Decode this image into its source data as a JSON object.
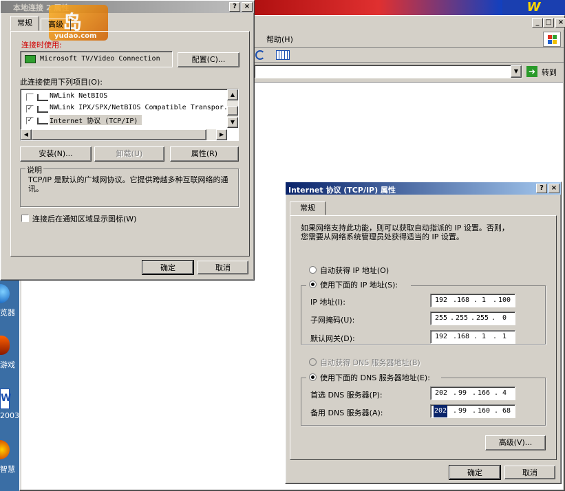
{
  "colors": {
    "desktop": "#3a6ea5",
    "titlebar_active": "#0a246a",
    "titlebar_inactive": "#808080",
    "face": "#d4d0c8"
  },
  "background_browser": {
    "menu_help": "帮助(H)",
    "go_label": "转到"
  },
  "desktop": {
    "icons": [
      {
        "label": "览器"
      },
      {
        "label": "游戏"
      },
      {
        "label": "2003"
      },
      {
        "label": "智慧"
      },
      {
        "label": "2"
      }
    ]
  },
  "watermark": {
    "text": "yudao.com",
    "glyph": "岛"
  },
  "lan_dialog": {
    "title": "本地连接 2 属性",
    "tabs": [
      "常规",
      "高级"
    ],
    "connect_using_label": "连接时使用:",
    "adapter_name": "Microsoft TV/Video Connection",
    "configure_button": "配置(C)...",
    "items_label": "此连接使用下列项目(O):",
    "items": [
      {
        "name": "NWLink NetBIOS",
        "checked": false
      },
      {
        "name": "NWLink IPX/SPX/NetBIOS Compatible Transpor.",
        "checked": true
      },
      {
        "name": "Internet 协议 (TCP/IP)",
        "checked": true
      }
    ],
    "install_button": "安装(N)...",
    "uninstall_button": "卸载(U)",
    "properties_button": "属性(R)",
    "description_label": "说明",
    "description_text": "TCP/IP 是默认的广域网协议。它提供跨越多种互联网络的通讯。",
    "notify_checkbox": "连接后在通知区域显示图标(W)",
    "ok_button": "确定",
    "cancel_button": "取消"
  },
  "tcp_dialog": {
    "title": "Internet 协议 (TCP/IP) 属性",
    "tab": "常规",
    "intro": [
      "如果网络支持此功能，则可以获取自动指派的 IP 设置。否则，",
      "您需要从网络系统管理员处获得适当的 IP 设置。"
    ],
    "auto_ip": "自动获得 IP 地址(O)",
    "use_ip": "使用下面的 IP 地址(S):",
    "ip_label": "IP 地址(I):",
    "ip": [
      "192",
      "168",
      "1",
      "100"
    ],
    "mask_label": "子网掩码(U):",
    "mask": [
      "255",
      "255",
      "255",
      "0"
    ],
    "gateway_label": "默认网关(D):",
    "gateway": [
      "192",
      "168",
      "1",
      "1"
    ],
    "auto_dns": "自动获得 DNS 服务器地址(B)",
    "use_dns": "使用下面的 DNS 服务器地址(E):",
    "pref_dns_label": "首选 DNS 服务器(P):",
    "pref_dns": [
      "202",
      "99",
      "166",
      "4"
    ],
    "alt_dns_label": "备用 DNS 服务器(A):",
    "alt_dns": [
      "202",
      "99",
      "160",
      "68"
    ],
    "advanced_button": "高级(V)...",
    "ok_button": "确定",
    "cancel_button": "取消"
  }
}
